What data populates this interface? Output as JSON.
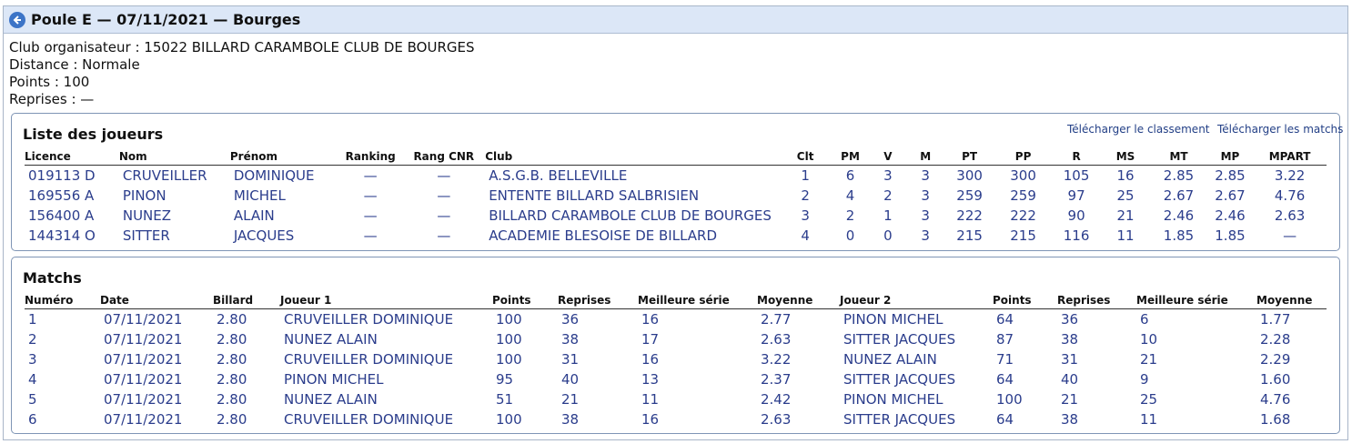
{
  "header": {
    "title": "Poule E — 07/11/2021 — Bourges"
  },
  "info": [
    "Club organisateur : 15022 BILLARD CARAMBOLE CLUB DE BOURGES",
    "Distance : Normale",
    "Points : 100",
    "Reprises : —"
  ],
  "players": {
    "title": "Liste des joueurs",
    "download_ranking": "Télécharger le classement",
    "download_matches": "Télécharger les matchs",
    "headers": [
      "Licence",
      "Nom",
      "Prénom",
      "Ranking",
      "Rang CNR",
      "Club",
      "Clt",
      "PM",
      "V",
      "M",
      "PT",
      "PP",
      "R",
      "MS",
      "MT",
      "MP",
      "MPART"
    ],
    "rows": [
      [
        "019113 D",
        "CRUVEILLER",
        "DOMINIQUE",
        "—",
        "—",
        "A.S.G.B. BELLEVILLE",
        "1",
        "6",
        "3",
        "3",
        "300",
        "300",
        "105",
        "16",
        "2.85",
        "2.85",
        "3.22"
      ],
      [
        "169556 A",
        "PINON",
        "MICHEL",
        "—",
        "—",
        "ENTENTE BILLARD SALBRISIEN",
        "2",
        "4",
        "2",
        "3",
        "259",
        "259",
        "97",
        "25",
        "2.67",
        "2.67",
        "4.76"
      ],
      [
        "156400 A",
        "NUNEZ",
        "ALAIN",
        "—",
        "—",
        "BILLARD CARAMBOLE CLUB DE BOURGES",
        "3",
        "2",
        "1",
        "3",
        "222",
        "222",
        "90",
        "21",
        "2.46",
        "2.46",
        "2.63"
      ],
      [
        "144314 O",
        "SITTER",
        "JACQUES",
        "—",
        "—",
        "ACADEMIE BLESOISE DE BILLARD",
        "4",
        "0",
        "0",
        "3",
        "215",
        "215",
        "116",
        "11",
        "1.85",
        "1.85",
        "—"
      ]
    ]
  },
  "matches": {
    "title": "Matchs",
    "headers": [
      "Numéro",
      "Date",
      "Billard",
      "Joueur 1",
      "Points",
      "Reprises",
      "Meilleure série",
      "Moyenne",
      "Joueur 2",
      "Points",
      "Reprises",
      "Meilleure série",
      "Moyenne"
    ],
    "rows": [
      [
        "1",
        "07/11/2021",
        "2.80",
        "CRUVEILLER DOMINIQUE",
        "100",
        "36",
        "16",
        "2.77",
        "PINON MICHEL",
        "64",
        "36",
        "6",
        "1.77"
      ],
      [
        "2",
        "07/11/2021",
        "2.80",
        "NUNEZ ALAIN",
        "100",
        "38",
        "17",
        "2.63",
        "SITTER JACQUES",
        "87",
        "38",
        "10",
        "2.28"
      ],
      [
        "3",
        "07/11/2021",
        "2.80",
        "CRUVEILLER DOMINIQUE",
        "100",
        "31",
        "16",
        "3.22",
        "NUNEZ ALAIN",
        "71",
        "31",
        "21",
        "2.29"
      ],
      [
        "4",
        "07/11/2021",
        "2.80",
        "PINON MICHEL",
        "95",
        "40",
        "13",
        "2.37",
        "SITTER JACQUES",
        "64",
        "40",
        "9",
        "1.60"
      ],
      [
        "5",
        "07/11/2021",
        "2.80",
        "NUNEZ ALAIN",
        "51",
        "21",
        "11",
        "2.42",
        "PINON MICHEL",
        "100",
        "21",
        "25",
        "4.76"
      ],
      [
        "6",
        "07/11/2021",
        "2.80",
        "CRUVEILLER DOMINIQUE",
        "100",
        "38",
        "16",
        "2.63",
        "SITTER JACQUES",
        "64",
        "38",
        "11",
        "1.68"
      ]
    ]
  }
}
